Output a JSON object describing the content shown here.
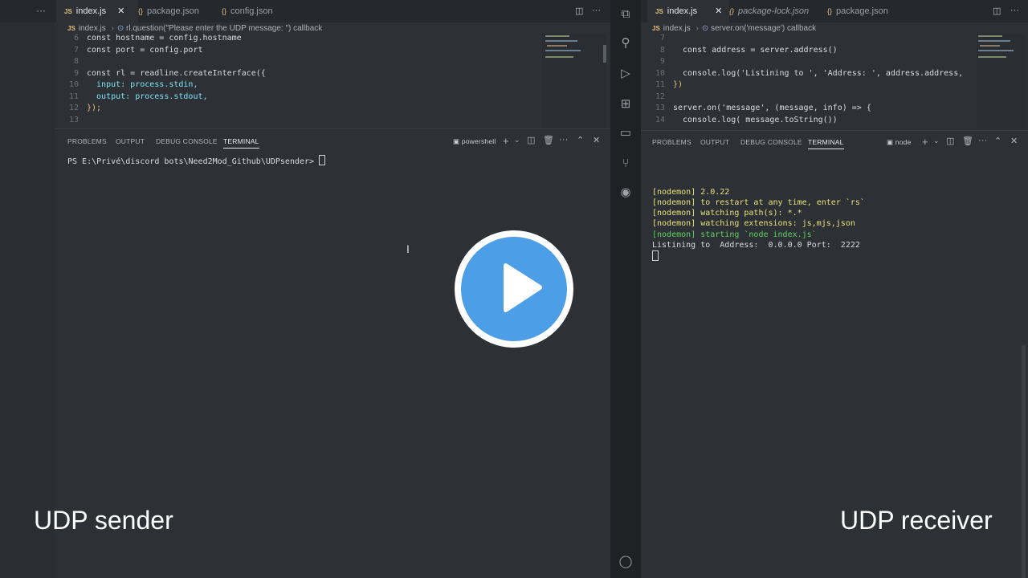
{
  "left": {
    "more": "···",
    "tabs": [
      {
        "label": "index.js",
        "badge": "JS",
        "active": true
      },
      {
        "label": "package.json",
        "badge": "{}"
      },
      {
        "label": "config.json",
        "badge": "{}"
      }
    ],
    "breadcrumb": {
      "file": "index.js",
      "symbol": "rl.question(\"Please enter the UDP message: \") callback"
    },
    "code": [
      {
        "ln": "6",
        "text": "const hostname = config.hostname"
      },
      {
        "ln": "7",
        "text": "const port = config.port"
      },
      {
        "ln": "8",
        "text": ""
      },
      {
        "ln": "9",
        "text": "const rl = readline.createInterface({"
      },
      {
        "ln": "10",
        "text": "  input: process.stdin,"
      },
      {
        "ln": "11",
        "text": "  output: process.stdout,"
      },
      {
        "ln": "12",
        "text": "});"
      },
      {
        "ln": "13",
        "text": ""
      }
    ],
    "panel_tabs": [
      "PROBLEMS",
      "OUTPUT",
      "DEBUG CONSOLE",
      "TERMINAL"
    ],
    "shell": "powershell",
    "prompt": "PS E:\\Privé\\discord bots\\Need2Mod_Github\\UDPsender> "
  },
  "right": {
    "tabs": [
      {
        "label": "index.js",
        "badge": "JS",
        "active": true
      },
      {
        "label": "package-lock.json",
        "badge": "{}"
      },
      {
        "label": "package.json",
        "badge": "{}"
      }
    ],
    "breadcrumb": {
      "file": "index.js",
      "symbol": "server.on('message') callback"
    },
    "code": [
      {
        "ln": "7",
        "text": ""
      },
      {
        "ln": "8",
        "text": "  const address = server.address()"
      },
      {
        "ln": "9",
        "text": ""
      },
      {
        "ln": "10",
        "text": "  console.log('Listining to ', 'Address: ', address.address,"
      },
      {
        "ln": "11",
        "text": "})"
      },
      {
        "ln": "12",
        "text": ""
      },
      {
        "ln": "13",
        "text": "server.on('message', (message, info) => {"
      },
      {
        "ln": "14",
        "text": "  console.log( message.toString())"
      }
    ],
    "panel_tabs": [
      "PROBLEMS",
      "OUTPUT",
      "DEBUG CONSOLE",
      "TERMINAL"
    ],
    "shell": "node",
    "terminal": [
      {
        "text": "[nodemon] 2.0.22",
        "color": "#e8e27a"
      },
      {
        "text": "[nodemon] to restart at any time, enter `rs`",
        "color": "#e8e27a"
      },
      {
        "text": "[nodemon] watching path(s): *.*",
        "color": "#e8e27a"
      },
      {
        "text": "[nodemon] watching extensions: js,mjs,json",
        "color": "#e8e27a"
      },
      {
        "text": "[nodemon] starting `node index.js`",
        "color": "#5fd35f"
      },
      {
        "text": "Listining to  Address:  0.0.0.0 Port:  2222",
        "color": "#d7dde4"
      }
    ]
  },
  "captions": {
    "left": "UDP sender",
    "right": "UDP receiver"
  },
  "colors": {
    "play": "#4c9ee6",
    "editor": "#2d3035"
  }
}
